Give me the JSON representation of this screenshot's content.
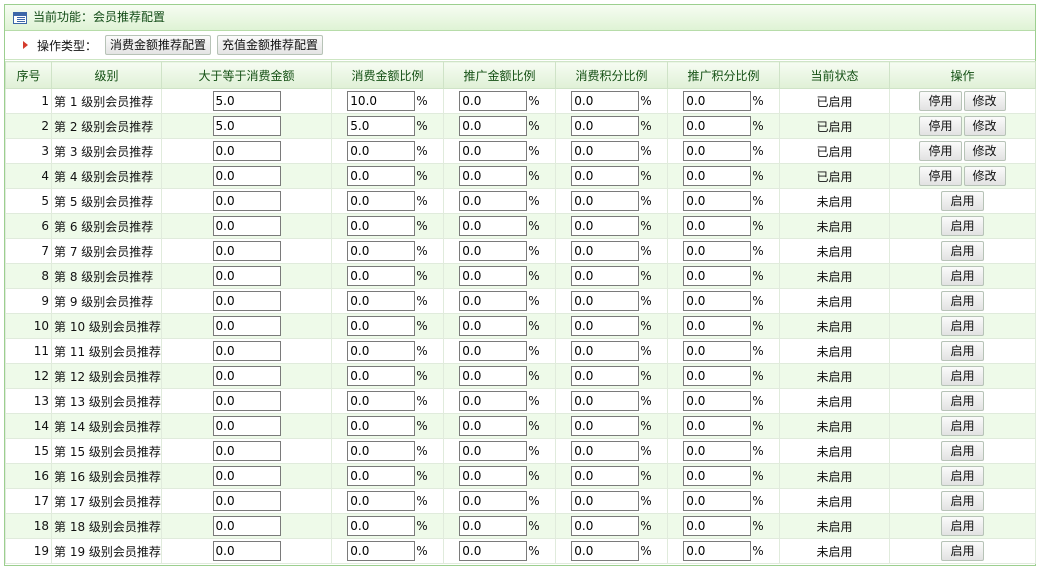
{
  "header": {
    "title": "当前功能：会员推荐配置"
  },
  "toolbar": {
    "label": "操作类型：",
    "buttons": [
      "消费金额推荐配置",
      "充值金额推荐配置"
    ]
  },
  "table": {
    "columns": [
      "序号",
      "级别",
      "大于等于消费金额",
      "消费金额比例",
      "推广金额比例",
      "消费积分比例",
      "推广积分比例",
      "当前状态",
      "操作"
    ],
    "percent_sign": "%",
    "rows": [
      {
        "seq": "1",
        "level": "第 1 级别会员推荐",
        "threshold": "5.0",
        "consume_ratio": "10.0",
        "promo_ratio": "0.0",
        "consume_points": "0.0",
        "promo_points": "0.0",
        "status": "已启用",
        "actions": [
          "停用",
          "修改"
        ]
      },
      {
        "seq": "2",
        "level": "第 2 级别会员推荐",
        "threshold": "5.0",
        "consume_ratio": "5.0",
        "promo_ratio": "0.0",
        "consume_points": "0.0",
        "promo_points": "0.0",
        "status": "已启用",
        "actions": [
          "停用",
          "修改"
        ]
      },
      {
        "seq": "3",
        "level": "第 3 级别会员推荐",
        "threshold": "0.0",
        "consume_ratio": "0.0",
        "promo_ratio": "0.0",
        "consume_points": "0.0",
        "promo_points": "0.0",
        "status": "已启用",
        "actions": [
          "停用",
          "修改"
        ]
      },
      {
        "seq": "4",
        "level": "第 4 级别会员推荐",
        "threshold": "0.0",
        "consume_ratio": "0.0",
        "promo_ratio": "0.0",
        "consume_points": "0.0",
        "promo_points": "0.0",
        "status": "已启用",
        "actions": [
          "停用",
          "修改"
        ]
      },
      {
        "seq": "5",
        "level": "第 5 级别会员推荐",
        "threshold": "0.0",
        "consume_ratio": "0.0",
        "promo_ratio": "0.0",
        "consume_points": "0.0",
        "promo_points": "0.0",
        "status": "未启用",
        "actions": [
          "启用"
        ]
      },
      {
        "seq": "6",
        "level": "第 6 级别会员推荐",
        "threshold": "0.0",
        "consume_ratio": "0.0",
        "promo_ratio": "0.0",
        "consume_points": "0.0",
        "promo_points": "0.0",
        "status": "未启用",
        "actions": [
          "启用"
        ]
      },
      {
        "seq": "7",
        "level": "第 7 级别会员推荐",
        "threshold": "0.0",
        "consume_ratio": "0.0",
        "promo_ratio": "0.0",
        "consume_points": "0.0",
        "promo_points": "0.0",
        "status": "未启用",
        "actions": [
          "启用"
        ]
      },
      {
        "seq": "8",
        "level": "第 8 级别会员推荐",
        "threshold": "0.0",
        "consume_ratio": "0.0",
        "promo_ratio": "0.0",
        "consume_points": "0.0",
        "promo_points": "0.0",
        "status": "未启用",
        "actions": [
          "启用"
        ]
      },
      {
        "seq": "9",
        "level": "第 9 级别会员推荐",
        "threshold": "0.0",
        "consume_ratio": "0.0",
        "promo_ratio": "0.0",
        "consume_points": "0.0",
        "promo_points": "0.0",
        "status": "未启用",
        "actions": [
          "启用"
        ]
      },
      {
        "seq": "10",
        "level": "第 10 级别会员推荐",
        "threshold": "0.0",
        "consume_ratio": "0.0",
        "promo_ratio": "0.0",
        "consume_points": "0.0",
        "promo_points": "0.0",
        "status": "未启用",
        "actions": [
          "启用"
        ]
      },
      {
        "seq": "11",
        "level": "第 11 级别会员推荐",
        "threshold": "0.0",
        "consume_ratio": "0.0",
        "promo_ratio": "0.0",
        "consume_points": "0.0",
        "promo_points": "0.0",
        "status": "未启用",
        "actions": [
          "启用"
        ]
      },
      {
        "seq": "12",
        "level": "第 12 级别会员推荐",
        "threshold": "0.0",
        "consume_ratio": "0.0",
        "promo_ratio": "0.0",
        "consume_points": "0.0",
        "promo_points": "0.0",
        "status": "未启用",
        "actions": [
          "启用"
        ]
      },
      {
        "seq": "13",
        "level": "第 13 级别会员推荐",
        "threshold": "0.0",
        "consume_ratio": "0.0",
        "promo_ratio": "0.0",
        "consume_points": "0.0",
        "promo_points": "0.0",
        "status": "未启用",
        "actions": [
          "启用"
        ]
      },
      {
        "seq": "14",
        "level": "第 14 级别会员推荐",
        "threshold": "0.0",
        "consume_ratio": "0.0",
        "promo_ratio": "0.0",
        "consume_points": "0.0",
        "promo_points": "0.0",
        "status": "未启用",
        "actions": [
          "启用"
        ]
      },
      {
        "seq": "15",
        "level": "第 15 级别会员推荐",
        "threshold": "0.0",
        "consume_ratio": "0.0",
        "promo_ratio": "0.0",
        "consume_points": "0.0",
        "promo_points": "0.0",
        "status": "未启用",
        "actions": [
          "启用"
        ]
      },
      {
        "seq": "16",
        "level": "第 16 级别会员推荐",
        "threshold": "0.0",
        "consume_ratio": "0.0",
        "promo_ratio": "0.0",
        "consume_points": "0.0",
        "promo_points": "0.0",
        "status": "未启用",
        "actions": [
          "启用"
        ]
      },
      {
        "seq": "17",
        "level": "第 17 级别会员推荐",
        "threshold": "0.0",
        "consume_ratio": "0.0",
        "promo_ratio": "0.0",
        "consume_points": "0.0",
        "promo_points": "0.0",
        "status": "未启用",
        "actions": [
          "启用"
        ]
      },
      {
        "seq": "18",
        "level": "第 18 级别会员推荐",
        "threshold": "0.0",
        "consume_ratio": "0.0",
        "promo_ratio": "0.0",
        "consume_points": "0.0",
        "promo_points": "0.0",
        "status": "未启用",
        "actions": [
          "启用"
        ]
      },
      {
        "seq": "19",
        "level": "第 19 级别会员推荐",
        "threshold": "0.0",
        "consume_ratio": "0.0",
        "promo_ratio": "0.0",
        "consume_points": "0.0",
        "promo_points": "0.0",
        "status": "未启用",
        "actions": [
          "启用"
        ]
      }
    ]
  },
  "colors": {
    "accent_green": "#9ccf8f",
    "header_text": "#145014",
    "alt_row": "#eefae9"
  }
}
